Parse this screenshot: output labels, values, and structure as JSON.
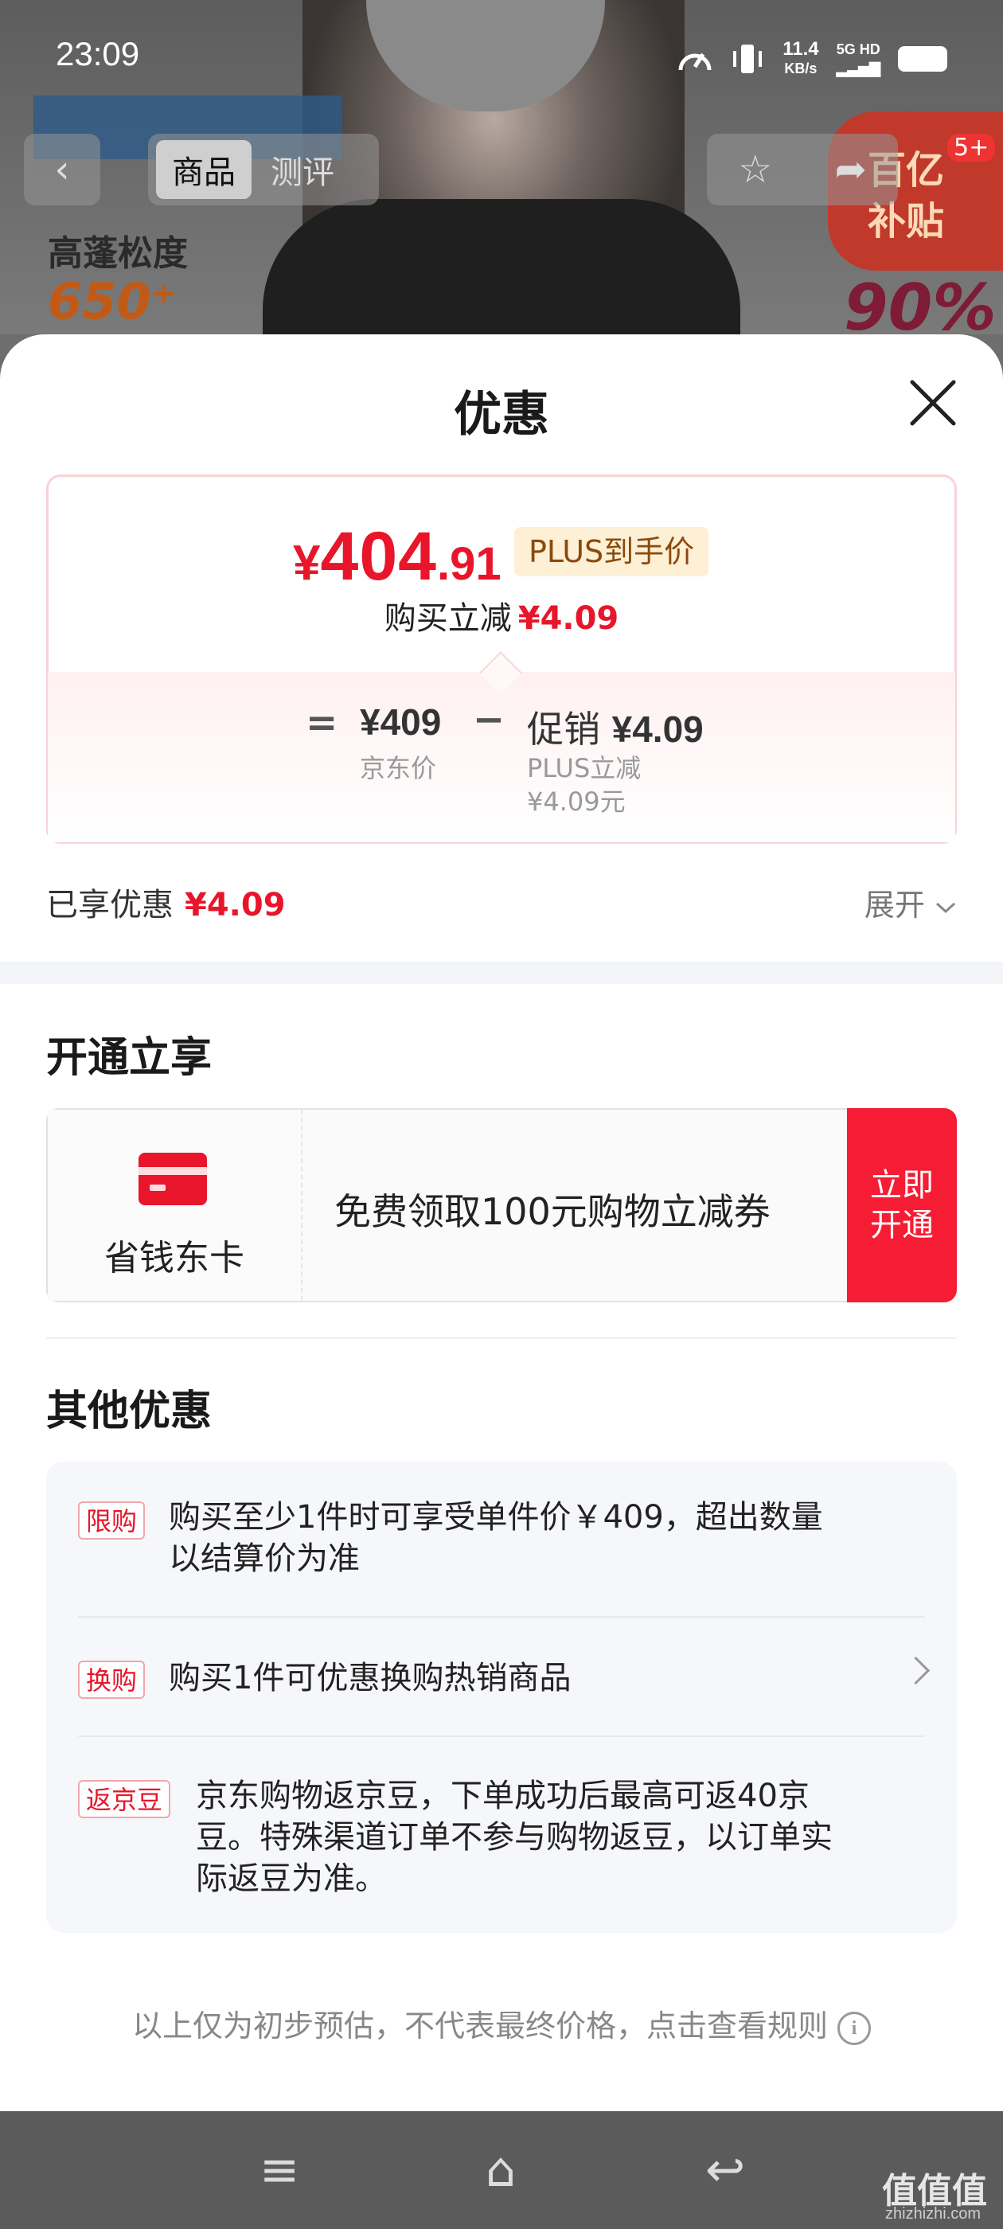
{
  "status_bar": {
    "time": "23:09",
    "net_speed_value": "11.4",
    "net_speed_unit": "KB/s",
    "network": "5G HD"
  },
  "background_page": {
    "tabs": [
      "商品",
      "测评"
    ],
    "active_tab": "商品",
    "banner_text_1": "高蓬松度",
    "banner_text_2": "650⁺",
    "subsidy_label": "百亿补贴",
    "subsidy_percent": "90%",
    "cart_badge": "5+"
  },
  "sheet": {
    "title": "优惠",
    "price": {
      "currency": "¥",
      "integer": "404",
      "decimal": ".91",
      "tag": "PLUS到手价"
    },
    "buy_reduce": {
      "label": "购买立减",
      "value": "¥4.09"
    },
    "breakdown": {
      "equals": "=",
      "jd_price": "¥409",
      "jd_price_label": "京东价",
      "minus": "−",
      "promo_label": "促销",
      "promo_value": "¥4.09",
      "promo_sub_1": "PLUS立减",
      "promo_sub_2": "¥4.09元"
    },
    "enjoyed": {
      "label": "已享优惠",
      "value": "¥4.09",
      "expand_label": "展开"
    },
    "open_section": {
      "title": "开通立享",
      "card_name": "省钱东卡",
      "description": "免费领取100元购物立减券",
      "button_line1": "立即",
      "button_line2": "开通"
    },
    "other_section": {
      "title": "其他优惠",
      "items": [
        {
          "tag": "限购",
          "line1": "购买至少1件时可享受单件价￥409，超出数量",
          "line2": "以结算价为准"
        },
        {
          "tag": "换购",
          "line1": "购买1件可优惠换购热销商品"
        },
        {
          "tag": "返京豆",
          "line1": "京东购物返京豆，下单成功后最高可返40京",
          "line2": "豆。特殊渠道订单不参与购物返豆，以订单实",
          "line3": "际返豆为准。"
        }
      ]
    },
    "footnote": "以上仅为初步预估，不代表最终价格，点击查看规则"
  },
  "nav_bar": {
    "menu_icon": "≡",
    "home_icon": "⌂",
    "back_icon": "↩"
  },
  "watermark": {
    "text": "值值值",
    "sub": "zhizhizhi.com"
  },
  "colors": {
    "accent_red": "#e8152b",
    "plus_gold_bg": "#fdf0d5",
    "button_red": "#f51c34"
  }
}
